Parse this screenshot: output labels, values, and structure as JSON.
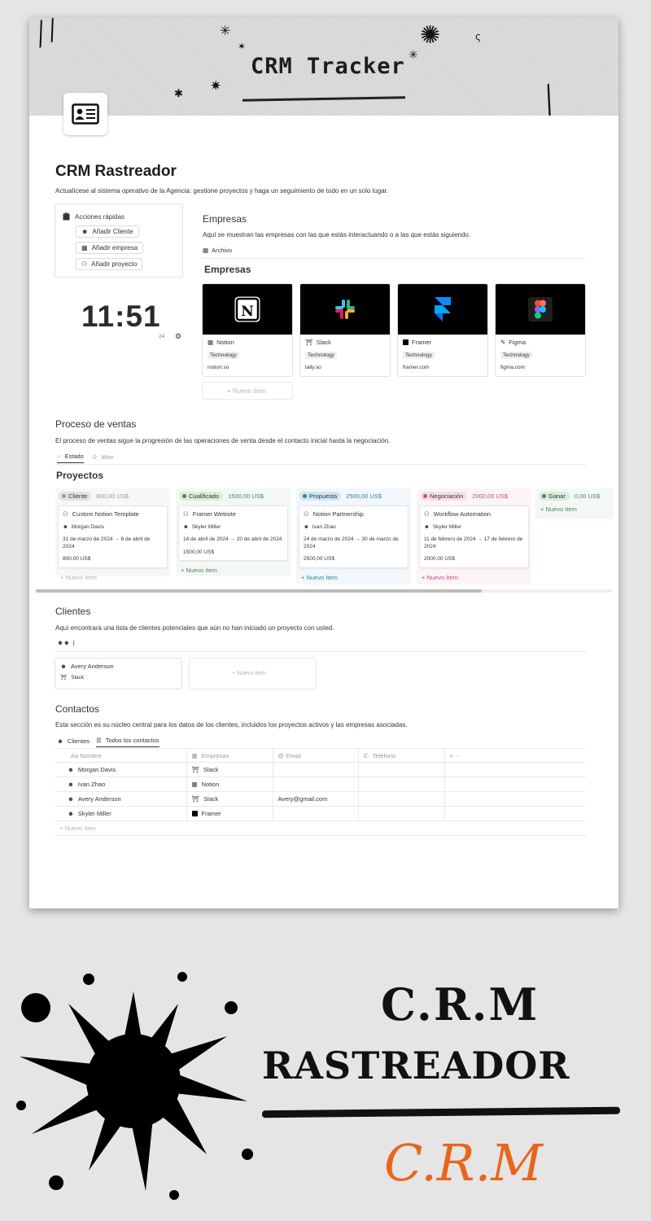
{
  "cover": {
    "title": "CRM Tracker"
  },
  "page": {
    "title": "CRM Rastreador",
    "description": "Actualícese al sistema operativo de la Agencia: gestione proyectos y haga un seguimiento de todo en un solo lugar."
  },
  "quick_actions": {
    "heading": "Acciones rápidas",
    "buttons": [
      "Añadir Cliente",
      "Añadir empresa",
      "Añadir proyecto"
    ]
  },
  "clock": {
    "time": "11:51",
    "hours_format": "24"
  },
  "empresas": {
    "heading": "Empresas",
    "description": "Aquí se muestran las empresas con las que estás interactuando o a las que estás siguiendo.",
    "archive_label": "Archivo",
    "gallery_title": "Empresas",
    "cards": [
      {
        "name": "Notion",
        "tag": "Technology",
        "url": "notion.so"
      },
      {
        "name": "Slack",
        "tag": "Technology",
        "url": "tally.so"
      },
      {
        "name": "Framer",
        "tag": "Technology",
        "url": "framer.com"
      },
      {
        "name": "Figma",
        "tag": "Technology",
        "url": "figma.com"
      }
    ],
    "new_item": "+ Nuevo ítem"
  },
  "ventas": {
    "heading": "Proceso de ventas",
    "description": "El proceso de ventas sigue la progresión de las operaciones de venta desde el contacto inicial hasta la negociación.",
    "tabs": [
      "Estado",
      "Won"
    ],
    "board_title": "Proyectos",
    "columns": [
      {
        "status": "Cliente",
        "total": "800,00 US$",
        "color": "#9b9a97",
        "bg": "#f7f7f5",
        "pill_bg": "#e3e2e0",
        "card": {
          "title": "Custom Notion Template",
          "person": "Morgan Davis",
          "dates": "31 de marzo de 2024 → 6 de abril de 2024",
          "amount": "800,00 US$"
        }
      },
      {
        "status": "Cualificado",
        "total": "1500,00 US$",
        "color": "#448361",
        "bg": "#f4f8f5",
        "pill_bg": "#dbeddb",
        "card": {
          "title": "Framer Website",
          "person": "Skyler Miller",
          "dates": "14 de abril de 2024 → 20 de abril de 2024",
          "amount": "1500,00 US$"
        }
      },
      {
        "status": "Propuesta",
        "total": "2500,00 US$",
        "color": "#337ea9",
        "bg": "#f1f7fb",
        "pill_bg": "#d3e5ef",
        "card": {
          "title": "Notion Partnership",
          "person": "Ivan Zhao",
          "dates": "24 de marzo de 2024 → 30 de marzo de 2024",
          "amount": "2500,00 US$"
        }
      },
      {
        "status": "Negociación",
        "total": "2000,00 US$",
        "color": "#c14c8a",
        "bg": "#fbf4f8",
        "pill_bg": "#f5e0e9",
        "card": {
          "title": "Workflow Automation",
          "person": "Skyler Miller",
          "dates": "11 de febrero de 2024 → 17 de febrero de 2024",
          "amount": "2000,00 US$"
        }
      },
      {
        "status": "Ganar",
        "total": "0,00 US$",
        "color": "#448361",
        "bg": "#f4f8f5",
        "pill_bg": "#dbeddb",
        "card": null
      }
    ],
    "new_item": "+ Nuevo ítem"
  },
  "clientes": {
    "heading": "Clientes",
    "description": "Aquí encontrará una lista de clientes potenciales que aún no han iniciado un proyecto con usted.",
    "view_label": "|",
    "card": {
      "name": "Avery Anderson",
      "company": "Slack"
    },
    "new_item": "+ Nuevo ítem"
  },
  "contactos": {
    "heading": "Contactos",
    "description": "Esta sección es su núcleo central para los datos de los clientes, incluidos los proyectos activos y las empresas asociadas.",
    "tabs": [
      "Clientes",
      "Todos los contactos"
    ],
    "columns": [
      "Aa Nombre",
      "Empresas",
      "@ Email",
      "Teléfono",
      "+ ···"
    ],
    "rows": [
      {
        "name": "Morgan Davis",
        "company": "Slack",
        "email": "",
        "phone": ""
      },
      {
        "name": "Ivan Zhao",
        "company": "Notion",
        "email": "",
        "phone": ""
      },
      {
        "name": "Avery Anderson",
        "company": "Slack",
        "email": "Avery@gmail.com",
        "phone": ""
      },
      {
        "name": "Skyler Miller",
        "company": "Framer",
        "email": "",
        "phone": ""
      }
    ],
    "new_item": "+ Nuevo ítem"
  },
  "branding": {
    "line1": "C.R.M",
    "line2": "RASTREADOR",
    "script": "C.R.M",
    "accent": "#e8661c"
  }
}
